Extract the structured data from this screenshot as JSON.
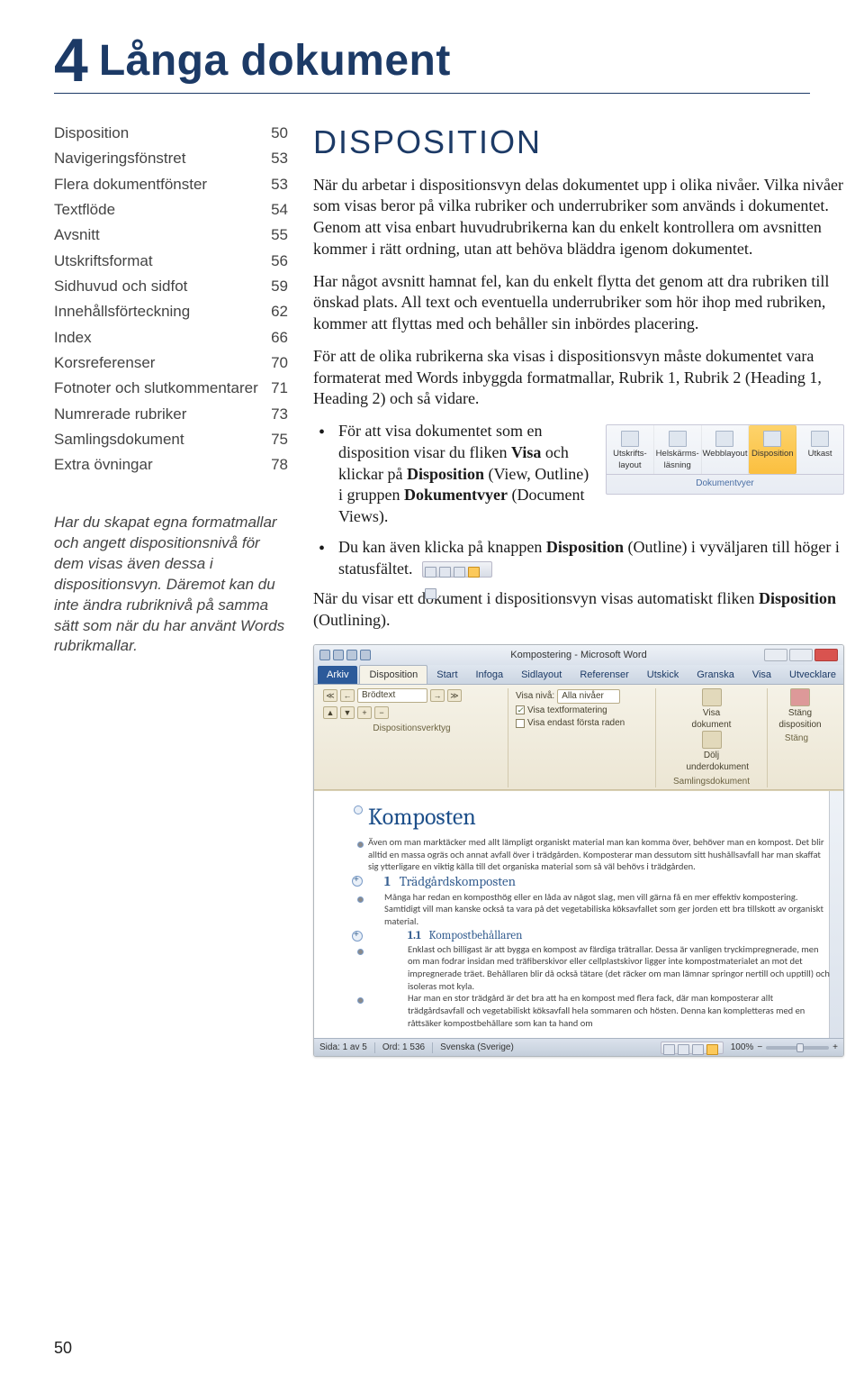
{
  "chapter_number": "4",
  "chapter_title": "Långa dokument",
  "toc": [
    {
      "label": "Disposition",
      "page": "50"
    },
    {
      "label": "Navigeringsfönstret",
      "page": "53"
    },
    {
      "label": "Flera dokument­fönster",
      "page": "53"
    },
    {
      "label": "Textflöde",
      "page": "54"
    },
    {
      "label": "Avsnitt",
      "page": "55"
    },
    {
      "label": "Utskriftsformat",
      "page": "56"
    },
    {
      "label": "Sidhuvud och sidfot",
      "page": "59"
    },
    {
      "label": "Innehållsförteckning",
      "page": "62"
    },
    {
      "label": "Index",
      "page": "66"
    },
    {
      "label": "Korsreferenser",
      "page": "70"
    },
    {
      "label": "Fotnoter och slutkommentarer",
      "page": "71"
    },
    {
      "label": "Numrerade rubriker",
      "page": "73"
    },
    {
      "label": "Samlingsdokument",
      "page": "75"
    },
    {
      "label": "Extra övningar",
      "page": "78"
    }
  ],
  "sidenote": "Har du skapat egna formatmallar och angett dispositionsnivå för dem visas även dessa i dispositionsvyn. Däremot kan du inte ändra rubriknivå på samma sätt som när du har använt Words rubrik­mallar.",
  "section_title": "DISPOSITION",
  "para1": "När du arbetar i dispositionsvyn delas dokumentet upp i olika nivåer. Vilka nivåer som visas beror på vilka rubriker och underrubriker som används i dokumentet. Genom att visa enbart huvudrubrikerna kan du enkelt kontrollera om avsnitten kommer i rätt ordning, utan att behöva bläddra igenom dokumentet.",
  "para2": "Har något avsnitt hamnat fel, kan du enkelt flytta det genom att dra rubriken till önskad plats. All text och eventuella underrubriker som hör ihop med rubriken, kommer att flyttas med och behåller sin inbördes placering.",
  "para3": "För att de olika rubrikerna ska visas i dispositionsvyn måste dokumentet vara formaterat med Words inbyggda formatmallar, Rubrik 1, Rubrik 2 (Heading 1, Heading 2) och så vidare.",
  "bullets": {
    "b1_a": "För att visa dokumentet som en disposition visar du fliken ",
    "b1_b": "Visa",
    "b1_c": " och klickar på ",
    "b1_d": "Disposition",
    "b1_e": " (View, Outline) i gruppen ",
    "b1_f": "Dokumentvyer",
    "b1_g": " (Document Views).",
    "b2_a": "Du kan även klicka på knappen ",
    "b2_b": "Disposition",
    "b2_c": " (Outline)  i vyväljaren till höger i statusfältet."
  },
  "para4_a": "När du visar ett dokument i dispositionsvyn visas automatiskt fliken ",
  "para4_b": "Disposition",
  "para4_c": " (Outlining).",
  "views_group": {
    "items": [
      "Utskrifts-\nlayout",
      "Helskärms-\nläsning",
      "Webblayout",
      "Disposition",
      "Utkast"
    ],
    "group_label": "Dokumentvyer"
  },
  "word_window": {
    "title": "Kompostering - Microsoft Word",
    "tabs": [
      "Arkiv",
      "Disposition",
      "Start",
      "Infoga",
      "Sidlayout",
      "Referenser",
      "Utskick",
      "Granska",
      "Visa",
      "Utvecklare"
    ],
    "level_box": "Brödtext",
    "show_level_label": "Visa nivå:",
    "show_level_value": "Alla nivåer",
    "chk_textfmt": "Visa textformatering",
    "chk_firstline": "Visa endast första raden",
    "btn_show": "Visa\ndokument",
    "btn_collapse": "Dölj\nunderdokument",
    "btn_close": "Stäng\ndisposition",
    "group1": "Dispositionsverktyg",
    "group2": "Samlingsdokument",
    "group3": "Stäng",
    "outline": {
      "h1": "Komposten",
      "p1": "Även om man marktäcker med allt lämpligt organiskt material man kan komma över, behöver man en kompost. Det blir alltid en massa ogräs och annat avfall över i trädgården. Komposterar man dessutom sitt hushållsavfall har man skaffat sig ytterligare en viktig källa till det organiska material som så väl behövs i trädgården.",
      "h2_num": "1",
      "h2": "Trädgårdskomposten",
      "p2": "Många har redan en komposthög eller en låda av något slag, men vill gärna få en mer effektiv kompostering. Samtidigt vill man kanske också ta vara på det vegetabiliska köksavfallet som ger jorden ett bra tillskott av organiskt material.",
      "h3_num": "1.1",
      "h3": "Kompostbehållaren",
      "p3": "Enklast och billigast är att bygga en kompost av färdiga trätrallar. Dessa är vanligen tryckimpregnerade, men om man fodrar insidan med träfiberskivor eller cellplastskivor ligger inte kompostmaterialet an mot det impregnerade träet. Behållaren blir då också tätare (det räcker om man lämnar springor nertill och upptill) och isoleras mot kyla.",
      "p4": "Har man en stor trädgård är det bra att ha en kompost med flera fack, där man komposterar allt trädgårdsavfall och vegetabiliskt köksavfall hela sommaren och hösten. Denna kan kompletteras med en råttsäker kompostbehållare som kan ta hand om"
    },
    "status": {
      "page": "Sida: 1 av 5",
      "words": "Ord: 1 536",
      "lang": "Svenska (Sverige)",
      "zoom": "100%"
    }
  },
  "page_number": "50"
}
